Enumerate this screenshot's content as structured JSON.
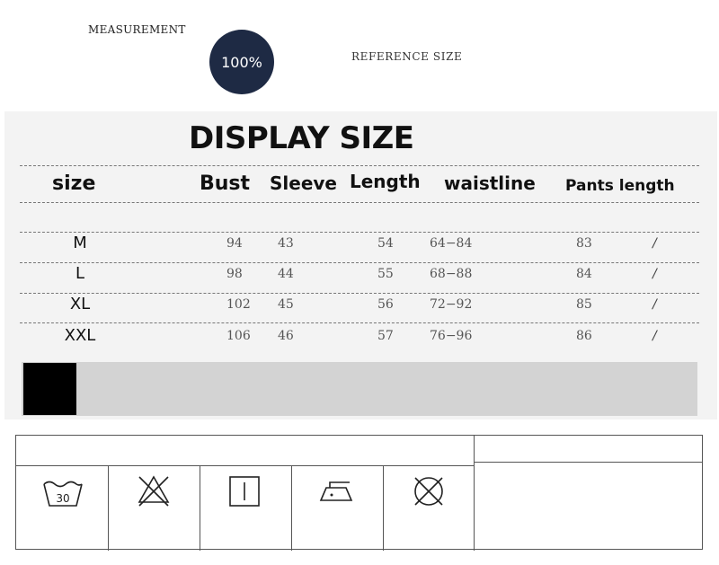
{
  "header": {
    "measurement_label": "MEASUREMENT",
    "badge": "100%",
    "reference_label": "REFERENCE SIZE"
  },
  "chart_data": {
    "type": "table",
    "title": "DISPLAY SIZE",
    "columns": [
      "size",
      "Bust",
      "Sleeve",
      "Length",
      "waistline",
      "Pants length"
    ],
    "rows": [
      {
        "size": "M",
        "bust": "94",
        "sleeve": "43",
        "length": "54",
        "waistline": "64−84",
        "pants_length": "83",
        "extra": "/"
      },
      {
        "size": "L",
        "bust": "98",
        "sleeve": "44",
        "length": "55",
        "waistline": "68−88",
        "pants_length": "84",
        "extra": "/"
      },
      {
        "size": "XL",
        "bust": "102",
        "sleeve": "45",
        "length": "56",
        "waistline": "72−92",
        "pants_length": "85",
        "extra": "/"
      },
      {
        "size": "XXL",
        "bust": "106",
        "sleeve": "46",
        "length": "57",
        "waistline": "76−96",
        "pants_length": "86",
        "extra": "/"
      }
    ]
  },
  "care": {
    "icons": [
      {
        "name": "wash-30-icon",
        "label": "30"
      },
      {
        "name": "do-not-bleach-icon"
      },
      {
        "name": "tumble-dry-icon"
      },
      {
        "name": "iron-icon"
      },
      {
        "name": "do-not-dry-clean-icon"
      }
    ]
  },
  "colors": {
    "badge_bg": "#1e2a44",
    "panel_bg": "#f3f3f3",
    "band_gray": "#d3d3d3",
    "band_black": "#000000"
  }
}
